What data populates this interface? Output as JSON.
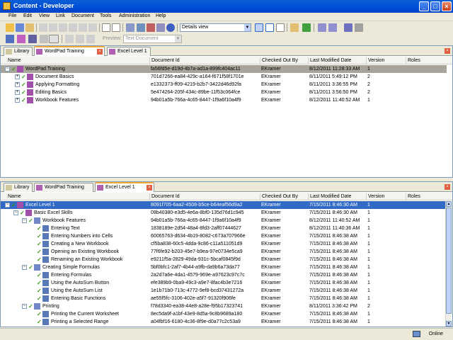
{
  "window": {
    "title": "Content - Developer"
  },
  "menu": [
    "File",
    "Edit",
    "View",
    "Link",
    "Document",
    "Tools",
    "Administration",
    "Help"
  ],
  "toolbar": {
    "view_combo": "Details view",
    "preview_label": "Preview:",
    "preview_combo": "Text Document"
  },
  "top_pane": {
    "tabs": [
      {
        "label": "Library",
        "active": false
      },
      {
        "label": "WordPad Training",
        "active": true
      },
      {
        "label": "Excel Level 1",
        "active": false
      }
    ],
    "columns": [
      "Name",
      "Document Id",
      "Checked Out By",
      "Last Modified Date",
      "Version",
      "Roles"
    ],
    "rows": [
      {
        "level": 0,
        "name": "WordPad Training",
        "id": "fa56fd5e-d19d-4b7a-ad1a-899fc404ac11",
        "by": "EKramer",
        "date": "8/12/2011 11:28:33 AM",
        "version": "1",
        "selected": true
      },
      {
        "level": 1,
        "name": "Document Basics",
        "id": "701d7266-ea84-429c-a164-f671f58f1701e",
        "by": "EKramer",
        "date": "8/11/2011 5:49:12 PM",
        "version": "2"
      },
      {
        "level": 1,
        "name": "Applying Formatting",
        "id": "e1332373-ff09-4219-b2b7-3422d46d92fa",
        "by": "EKramer",
        "date": "8/11/2011 3:36:55 PM",
        "version": "2"
      },
      {
        "level": 1,
        "name": "Editing Basics",
        "id": "5e474264-205f-434c-89be-11f53c064fce",
        "by": "EKramer",
        "date": "8/11/2011 3:56:50 PM",
        "version": "2"
      },
      {
        "level": 1,
        "name": "Workbook Features",
        "id": "94b01a5b-766a-4c65-8447-1f9a6f10a4f9",
        "by": "EKramer",
        "date": "8/12/2011 11:40:52 AM",
        "version": "1"
      }
    ]
  },
  "bottom_pane": {
    "tabs": [
      {
        "label": "Library",
        "active": false
      },
      {
        "label": "WordPad Training",
        "active": false
      },
      {
        "label": "Excel Level 1",
        "active": true
      }
    ],
    "columns": [
      "Name",
      "Document Id",
      "Checked Out By",
      "Last Modified Date",
      "Version",
      "Roles"
    ],
    "rows": [
      {
        "level": 0,
        "name": "Excel Level 1",
        "id": "8091f705-6aa2-4508-b5ce-b64eaf56d9a2",
        "by": "EKramer",
        "date": "7/15/2011 8:46:30 AM",
        "version": "1",
        "highlight": true,
        "type": "book"
      },
      {
        "level": 1,
        "name": "Basic Excel Skills",
        "id": "09b40380-e3d5-4e6a-8bf0-135d76d1c945",
        "by": "EKramer",
        "date": "7/15/2011 8:46:30 AM",
        "version": "1",
        "type": "book"
      },
      {
        "level": 2,
        "name": "Workbook Features",
        "id": "94b01a5b-766a-4c65-8447-1f9a6f10a4f9",
        "by": "EKramer",
        "date": "8/12/2011 11:40:52 AM",
        "version": "1",
        "type": "folder"
      },
      {
        "level": 3,
        "name": "Entering Text",
        "id": "1838189e-2d54-48a4-8fd3-2aff07444627",
        "by": "EKramer",
        "date": "8/12/2011 11:40:36 AM",
        "version": "1",
        "type": "doc"
      },
      {
        "level": 3,
        "name": "Entering Numbers into Cells",
        "id": "60065763-d634-4b19-8082-c673a707966e",
        "by": "EKramer",
        "date": "7/15/2011 8:46:38 AM",
        "version": "1",
        "type": "doc"
      },
      {
        "level": 3,
        "name": "Creating a New Workbook",
        "id": "cf5ba838-60c5-4dda-9c86-c11a511051d9",
        "by": "EKramer",
        "date": "7/15/2011 8:46:38 AM",
        "version": "1",
        "type": "doc"
      },
      {
        "level": 3,
        "name": "Opening an Existing Workbook",
        "id": "77f6fe92-b203-45e7-b9ea-97e0734e5ca9",
        "by": "EKramer",
        "date": "7/15/2011 8:46:38 AM",
        "version": "1",
        "type": "doc"
      },
      {
        "level": 3,
        "name": "Renaming an Existing Workbook",
        "id": "e9211f5a-2829-49da-931c-5bcaf0845f9d",
        "by": "EKramer",
        "date": "7/15/2011 8:46:38 AM",
        "version": "1",
        "type": "doc"
      },
      {
        "level": 2,
        "name": "Creating Simple Formulas",
        "id": "5bf0bfc1-2af7-4b44-a9fb-da9b6a73da77",
        "by": "EKramer",
        "date": "7/15/2011 8:46:38 AM",
        "version": "1",
        "type": "folder"
      },
      {
        "level": 3,
        "name": "Entering Formulas",
        "id": "2a2d7a6e-4da1-4579-969e-a97623c97c7c",
        "by": "EKramer",
        "date": "7/15/2011 8:46:38 AM",
        "version": "1",
        "type": "doc"
      },
      {
        "level": 3,
        "name": "Using the AutoSum Button",
        "id": "efe389b9-0ba9-49c3-a9e7-8fac4b3e7216",
        "by": "EKramer",
        "date": "7/15/2011 8:46:38 AM",
        "version": "1",
        "type": "doc"
      },
      {
        "level": 3,
        "name": "Using the AutoSum List",
        "id": "1e1b71b0-713c-4772-9ef8-bcd37431272a",
        "by": "EKramer",
        "date": "7/15/2011 8:46:38 AM",
        "version": "1",
        "type": "doc"
      },
      {
        "level": 3,
        "name": "Entering Basic Functions",
        "id": "ae55f5fc-3106-402e-a5f7-91320f906fe",
        "by": "EKramer",
        "date": "7/15/2011 8:46:38 AM",
        "version": "1",
        "type": "doc"
      },
      {
        "level": 2,
        "name": "Printing",
        "id": "f78d3340-ea38-44e8-a28e-f95b17323741",
        "by": "EKramer",
        "date": "8/11/2011 3:36:42 PM",
        "version": "2",
        "type": "folder"
      },
      {
        "level": 3,
        "name": "Printing the Current Worksheet",
        "id": "8ec5da9f-a1bf-43e9-8d5a-9c8b9689a180",
        "by": "EKramer",
        "date": "7/15/2011 8:46:38 AM",
        "version": "1",
        "type": "doc"
      },
      {
        "level": 3,
        "name": "Printing a Selected Range",
        "id": "a04fbf16-6180-4c36-8f9e-d0a77c2c53a9",
        "by": "EKramer",
        "date": "7/15/2011 8:46:38 AM",
        "version": "1",
        "type": "doc"
      }
    ]
  },
  "status": {
    "text": "Online"
  }
}
